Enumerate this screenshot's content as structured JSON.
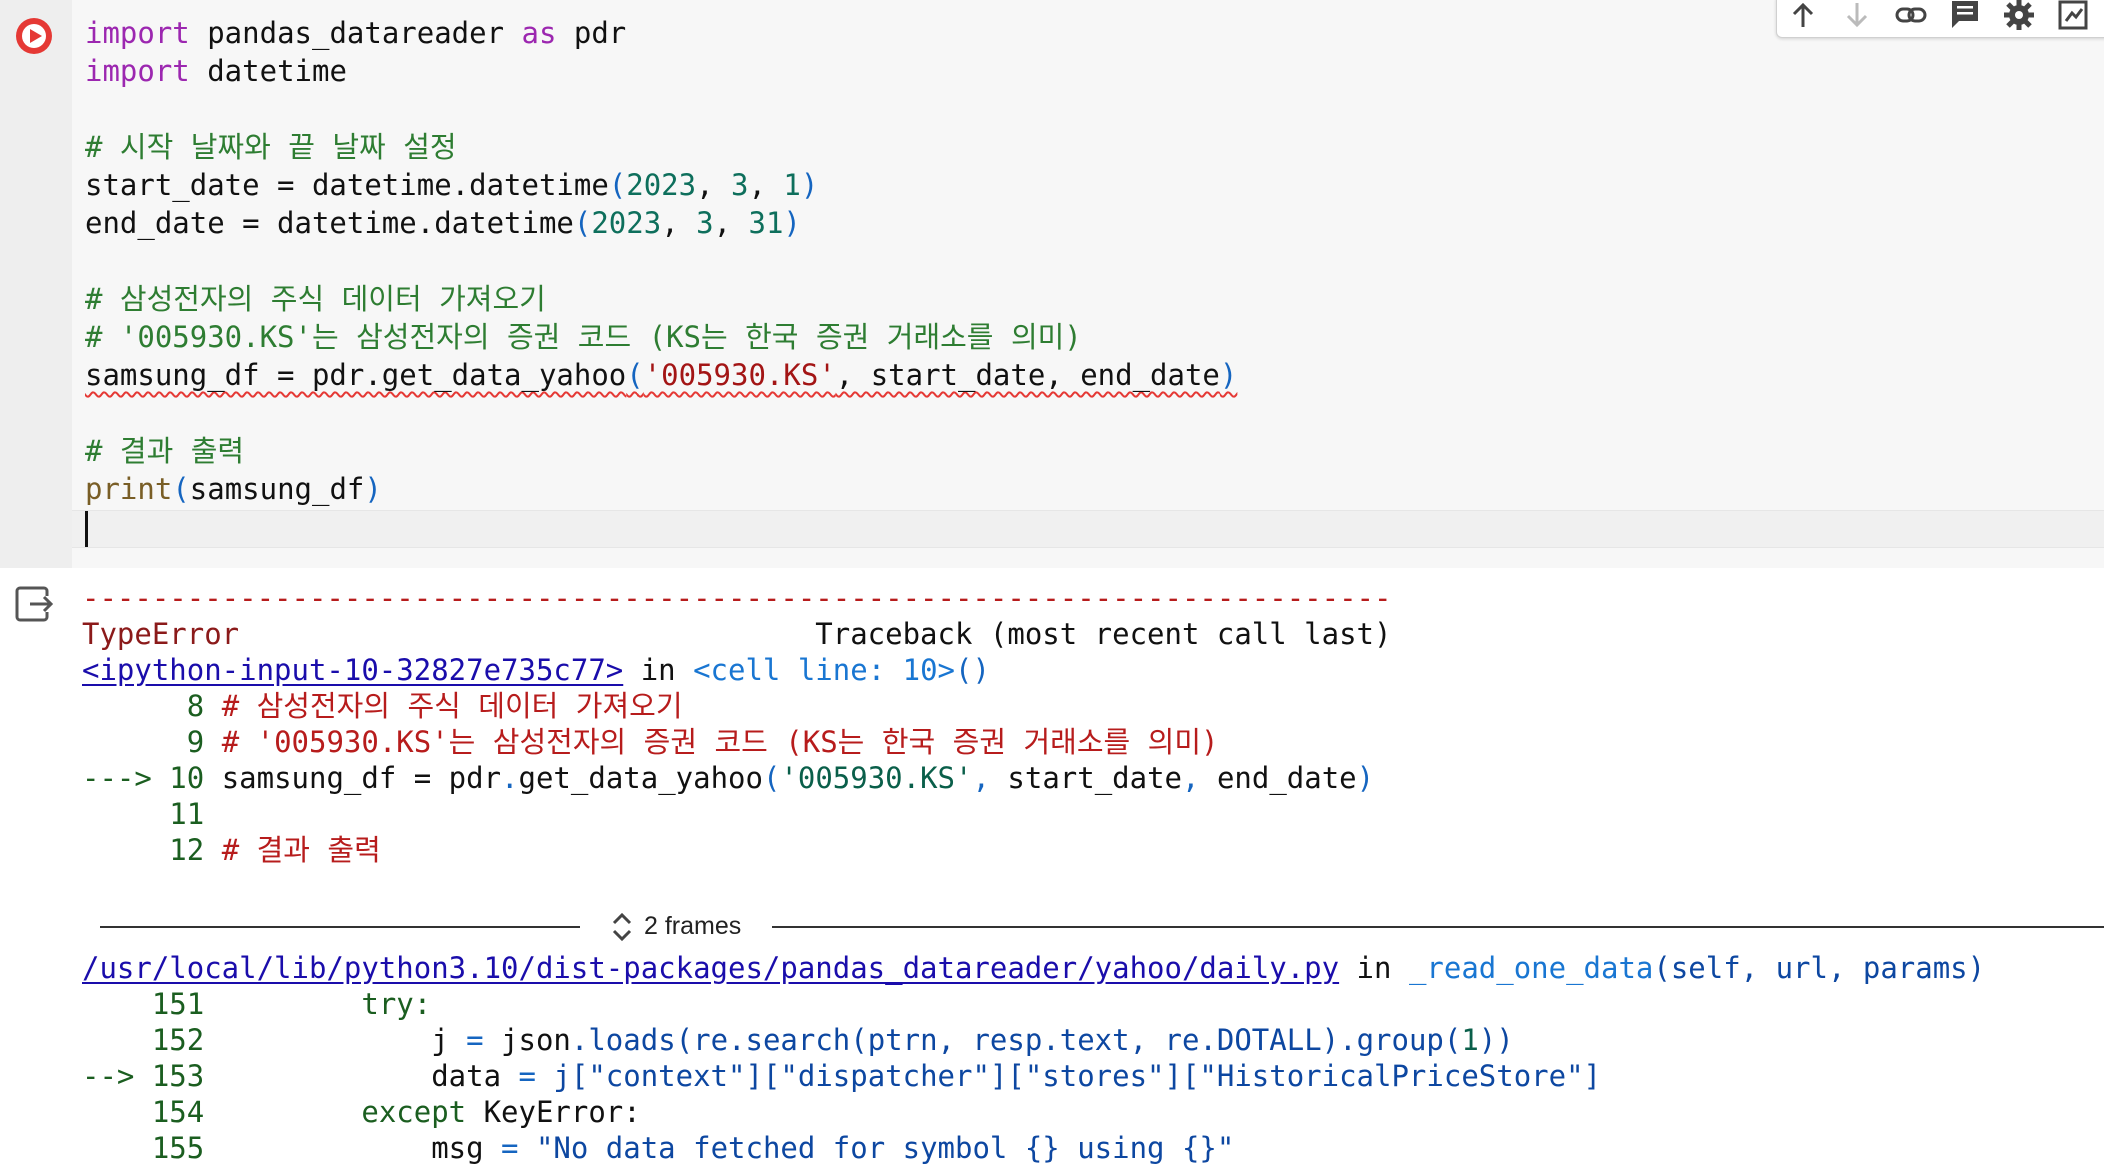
{
  "code_cell": {
    "lines": {
      "l1": [
        "import",
        " pandas_datareader ",
        "as",
        " pdr"
      ],
      "l2": [
        "import",
        " datetime"
      ],
      "l4": "# 시작 날짜와 끝 날짜 설정",
      "l5": [
        "start_date = datetime.datetime",
        "(",
        "2023",
        ", ",
        "3",
        ", ",
        "1",
        ")"
      ],
      "l6": [
        "end_date = datetime.datetime",
        "(",
        "2023",
        ", ",
        "3",
        ", ",
        "31",
        ")"
      ],
      "l8": "# 삼성전자의 주식 데이터 가져오기",
      "l9": "# '005930.KS'는 삼성전자의 증권 코드 (KS는 한국 증권 거래소를 의미)",
      "l10": [
        "samsung_df = pdr.get_data_yahoo",
        "(",
        "'005930.KS'",
        ", start_date, end_date",
        ")"
      ],
      "l12": "# 결과 출력",
      "l13": [
        "print",
        "(",
        "samsung_df",
        ")"
      ]
    }
  },
  "toolbar": {
    "icons": [
      "arrow-up-icon",
      "arrow-down-icon",
      "link-icon",
      "comment-icon",
      "gear-icon",
      "mirror-cell-icon"
    ]
  },
  "output": {
    "dashes": "---------------------------------------------------------------------------",
    "error_type": "TypeError",
    "traceback_header": "                                 Traceback (most recent call last)",
    "input_link": "<ipython-input-10-32827e735c77>",
    "in_text": " in ",
    "cell_ref": "<cell line: 10>",
    "cell_ref_parens": "()",
    "tb_lines": {
      "a_num": "      8 ",
      "a_text": "# 삼성전자의 주식 데이터 가져오기",
      "b_num": "      9 ",
      "b_text": "# '005930.KS'는 삼성전자의 증권 코드 (KS는 한국 증권 거래소를 의미)",
      "c_arrow": "---> 10 ",
      "c_text1": "samsung_df = pdr",
      "c_dot": ".",
      "c_text2": "get_data_yahoo",
      "c_paren_open": "(",
      "c_str": "'005930.KS'",
      "c_comma1": ", ",
      "c_arg1": "start_date",
      "c_comma2": ", ",
      "c_arg2": "end_date",
      "c_paren_close": ")",
      "d_num": "     11",
      "e_num": "     12 ",
      "e_text": "# 결과 출력"
    },
    "frames_label": "2 frames",
    "file_link": "/usr/local/lib/python3.10/dist-packages/pandas_datareader/yahoo/daily.py",
    "file_in": " in ",
    "func_name": "_read_one_data",
    "func_args": "(self, url, params)",
    "src": {
      "n151": "    151 ",
      "t151": "        try:",
      "n152": "    152 ",
      "t152a": "            j ",
      "t152b": "= ",
      "t152c": "json",
      "t152d": ".loads(re.search(ptrn, resp.text, re.DOTALL).group(",
      "t152e": "1",
      "t152f": "))",
      "n153": "--> 153 ",
      "t153a": "            data ",
      "t153b": "= ",
      "t153c": "j[\"context\"][\"dispatcher\"][\"stores\"][\"HistoricalPriceStore\"]",
      "n154": "    154 ",
      "t154a": "        except ",
      "t154b": "KeyError:",
      "n155": "    155 ",
      "t155a": "            msg ",
      "t155b": "= ",
      "t155c": "\"No data fetched for symbol {} using {}\""
    }
  }
}
